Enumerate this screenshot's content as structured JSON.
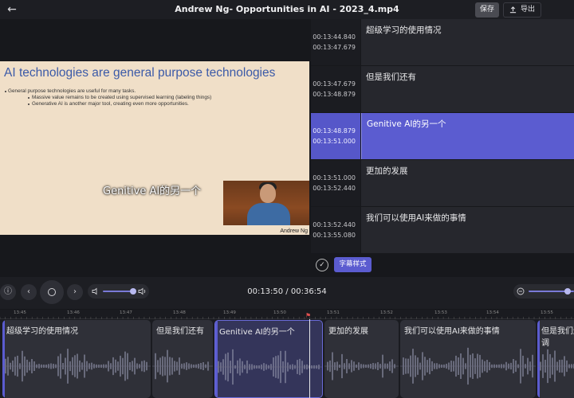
{
  "topbar": {
    "title": "Andrew Ng- Opportunities in AI - 2023_4.mp4",
    "save_label": "保存",
    "export_label": "导出"
  },
  "video": {
    "slide_title": "AI technologies are general purpose technologies",
    "bullets": [
      "General purpose technologies are useful for many tasks.",
      "Massive value remains to be created using supervised learning (labeling things)",
      "Generative AI is another major tool, creating even more opportunities."
    ],
    "speaker_name": "Andrew Ng",
    "overlay_subtitle": "Genitive AI的另一个"
  },
  "subtitles": [
    {
      "start": "00:13:44.840",
      "end": "00:13:47.679",
      "text": "超级学习的使用情况",
      "active": false
    },
    {
      "start": "00:13:47.679",
      "end": "00:13:48.879",
      "text": "但是我们还有",
      "active": false
    },
    {
      "start": "00:13:48.879",
      "end": "00:13:51.000",
      "text": "Genitive AI的另一个",
      "active": true
    },
    {
      "start": "00:13:51.000",
      "end": "00:13:52.440",
      "text": "更加的发展",
      "active": false
    },
    {
      "start": "00:13:52.440",
      "end": "00:13:55.080",
      "text": "我们可以使用AI来做的事情",
      "active": false
    }
  ],
  "subtitle_actions": {
    "style_label": "字幕样式"
  },
  "player": {
    "time_display": "00:13:50 / 00:36:54",
    "volume_level": 0.75,
    "zoom_level": 0.8
  },
  "timeline": {
    "ticks": [
      "13:45",
      "13:46",
      "13:47",
      "13:48",
      "13:49",
      "13:50",
      "13:51",
      "13:52",
      "13:53",
      "13:54",
      "13:55"
    ],
    "clips": [
      {
        "text": "超级学习的使用情况",
        "active": false
      },
      {
        "text": "但是我们还有",
        "active": false
      },
      {
        "text": "Genitive AI的另一个",
        "active": true
      },
      {
        "text": "更加的发展",
        "active": false
      },
      {
        "text": "我们可以使用AI来做的事情",
        "active": false
      },
      {
        "text": "但是我们还有",
        "text2": "调",
        "active": false
      }
    ]
  },
  "colors": {
    "accent": "#5b5cd0",
    "background": "#17181c"
  }
}
